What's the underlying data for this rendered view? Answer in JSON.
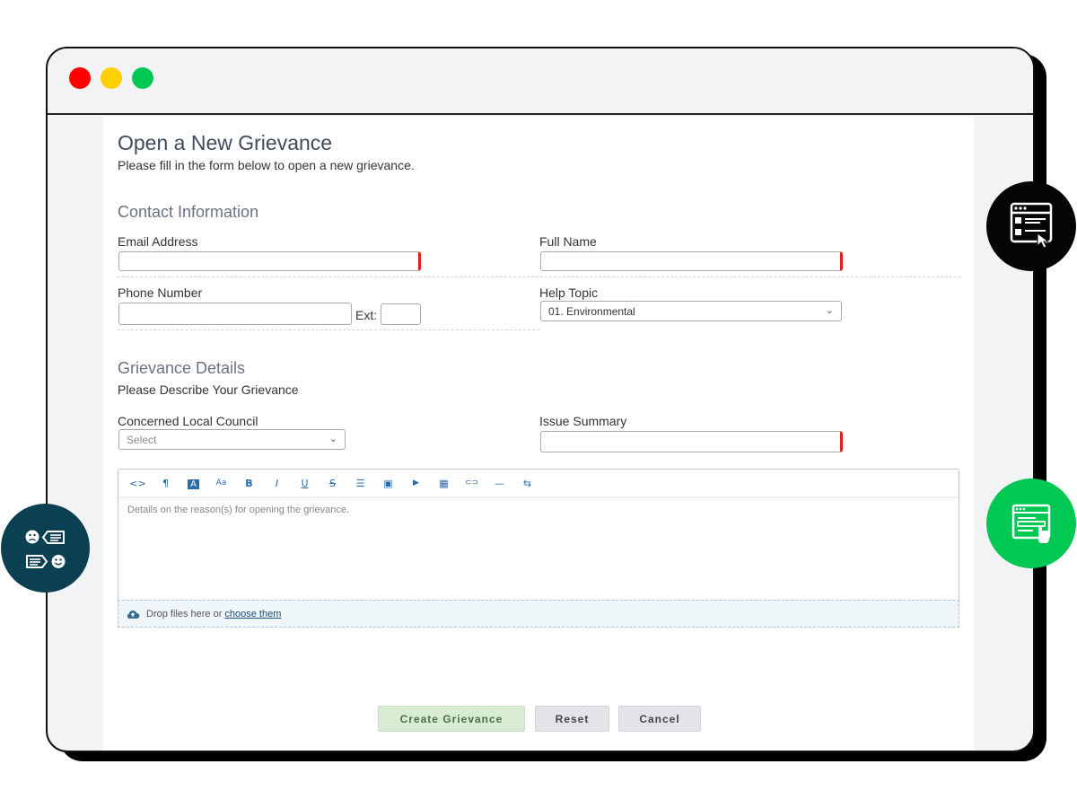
{
  "page": {
    "title": "Open a New Grievance",
    "subtitle": "Please fill in the form below to open a new grievance."
  },
  "contact": {
    "heading": "Contact Information",
    "email_label": "Email Address",
    "email_value": "",
    "name_label": "Full Name",
    "name_value": "",
    "phone_label": "Phone Number",
    "phone_value": "",
    "ext_label": "Ext:",
    "ext_value": "",
    "topic_label": "Help Topic",
    "topic_value": "01. Environmental"
  },
  "details": {
    "heading": "Grievance Details",
    "prompt": "Please Describe Your Grievance",
    "council_label": "Concerned Local Council",
    "council_value": "Select",
    "summary_label": "Issue Summary",
    "summary_value": "",
    "editor_placeholder": "Details on the reason(s) for opening the grievance.",
    "drop_text": "Drop files here or",
    "drop_link": "choose them"
  },
  "toolbar": {
    "code": "<>",
    "paragraph": "¶",
    "font_color": "A",
    "font_size": "Aa",
    "bold": "B",
    "italic": "I",
    "underline": "U",
    "strike": "S",
    "list": "☰",
    "image": "▣",
    "video": "▶",
    "table": "▦",
    "link": "⊂⊃",
    "hr": "—",
    "direction": "⇆"
  },
  "buttons": {
    "create": "Create Grievance",
    "reset": "Reset",
    "cancel": "Cancel"
  },
  "colors": {
    "required_marker": "#e0201f",
    "primary_button": "#d7ecd3",
    "badge_black": "#050505",
    "badge_green": "#00c853",
    "badge_teal": "#0b3f52"
  },
  "icons": {
    "black_badge": "checklist-browser-icon",
    "green_badge": "form-browser-icon",
    "teal_badge": "feedback-faces-icon"
  }
}
